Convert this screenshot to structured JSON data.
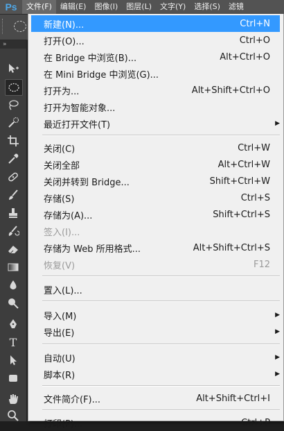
{
  "app": {
    "logo": "Ps"
  },
  "menubar": [
    {
      "label": "文件(F)"
    },
    {
      "label": "编辑(E)"
    },
    {
      "label": "图像(I)"
    },
    {
      "label": "图层(L)"
    },
    {
      "label": "文字(Y)"
    },
    {
      "label": "选择(S)"
    },
    {
      "label": "滤镜"
    }
  ],
  "toolpanel": {
    "header": "»"
  },
  "file_menu": {
    "items": [
      {
        "label": "新建(N)...",
        "shortcut": "Ctrl+N"
      },
      {
        "label": "打开(O)...",
        "shortcut": "Ctrl+O"
      },
      {
        "label": "在 Bridge 中浏览(B)...",
        "shortcut": "Alt+Ctrl+O"
      },
      {
        "label": "在 Mini Bridge 中浏览(G)...",
        "shortcut": ""
      },
      {
        "label": "打开为...",
        "shortcut": "Alt+Shift+Ctrl+O"
      },
      {
        "label": "打开为智能对象...",
        "shortcut": ""
      },
      {
        "label": "最近打开文件(T)",
        "shortcut": ""
      },
      {
        "label": "关闭(C)",
        "shortcut": "Ctrl+W"
      },
      {
        "label": "关闭全部",
        "shortcut": "Alt+Ctrl+W"
      },
      {
        "label": "关闭并转到 Bridge...",
        "shortcut": "Shift+Ctrl+W"
      },
      {
        "label": "存储(S)",
        "shortcut": "Ctrl+S"
      },
      {
        "label": "存储为(A)...",
        "shortcut": "Shift+Ctrl+S"
      },
      {
        "label": "签入(I)...",
        "shortcut": ""
      },
      {
        "label": "存储为 Web 所用格式...",
        "shortcut": "Alt+Shift+Ctrl+S"
      },
      {
        "label": "恢复(V)",
        "shortcut": "F12"
      },
      {
        "label": "置入(L)...",
        "shortcut": ""
      },
      {
        "label": "导入(M)",
        "shortcut": ""
      },
      {
        "label": "导出(E)",
        "shortcut": ""
      },
      {
        "label": "自动(U)",
        "shortcut": ""
      },
      {
        "label": "脚本(R)",
        "shortcut": ""
      },
      {
        "label": "文件简介(F)...",
        "shortcut": "Alt+Shift+Ctrl+I"
      },
      {
        "label": "打印(P)...",
        "shortcut": "Ctrl+P"
      }
    ],
    "submenu_arrow": "▶"
  },
  "colors": {
    "highlight": "#3399ff",
    "menu_bg": "#f0f0f0",
    "disabled_text": "#9a9a9a"
  }
}
